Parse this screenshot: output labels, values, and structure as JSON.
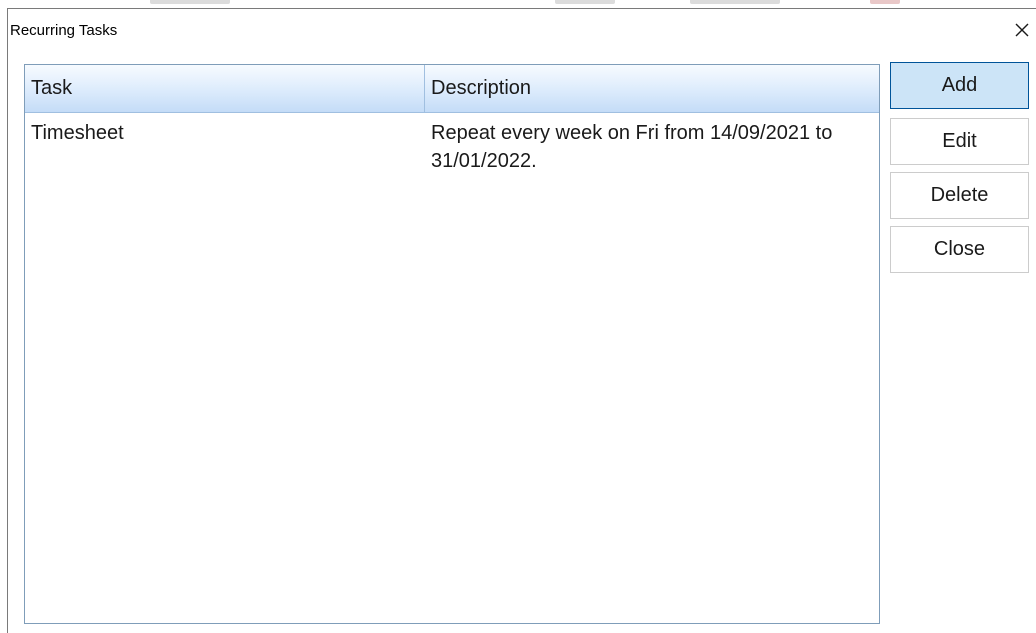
{
  "window": {
    "title": "Recurring Tasks",
    "close_icon": "close-icon"
  },
  "list": {
    "columns": [
      "Task",
      "Description"
    ],
    "rows": [
      {
        "task": "Timesheet",
        "description": "Repeat every week on Fri from 14/09/2021 to 31/01/2022."
      }
    ]
  },
  "buttons": {
    "add": "Add",
    "edit": "Edit",
    "delete": "Delete",
    "close": "Close"
  },
  "colors": {
    "accent_button_bg": "#cce4f7",
    "accent_button_border": "#005499",
    "list_border": "#7f9db9"
  }
}
